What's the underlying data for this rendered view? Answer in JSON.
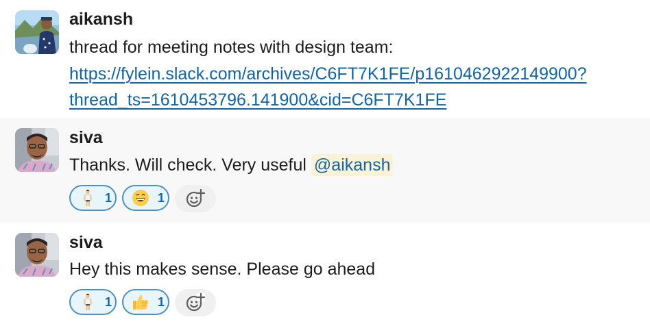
{
  "messages": [
    {
      "author": "aikansh",
      "text_line1": "thread for meeting notes with design team:",
      "link_line1": "https://fylein.slack.com/archives/C6FT7K1FE/p1610462922149900?",
      "link_line2": "thread_ts=1610453796.141900&cid=C6FT7K1FE"
    },
    {
      "author": "siva",
      "text": "Thanks. Will check. Very useful",
      "mention": "@aikansh",
      "reactions": [
        {
          "icon": "standing-person-icon",
          "count": "1"
        },
        {
          "icon": "grinning-face-icon",
          "count": "1"
        }
      ]
    },
    {
      "author": "siva",
      "text": "Hey this makes sense. Please go ahead",
      "reactions": [
        {
          "icon": "standing-person-icon",
          "count": "1"
        },
        {
          "icon": "thumbs-up-icon",
          "count": "1"
        }
      ]
    }
  ],
  "colors": {
    "link": "#1264a3",
    "mention_bg": "#fcf3d7",
    "reaction_border": "#4b90c4",
    "reaction_bg": "#e8f5fa",
    "hover_bg": "#f8f8f8"
  }
}
